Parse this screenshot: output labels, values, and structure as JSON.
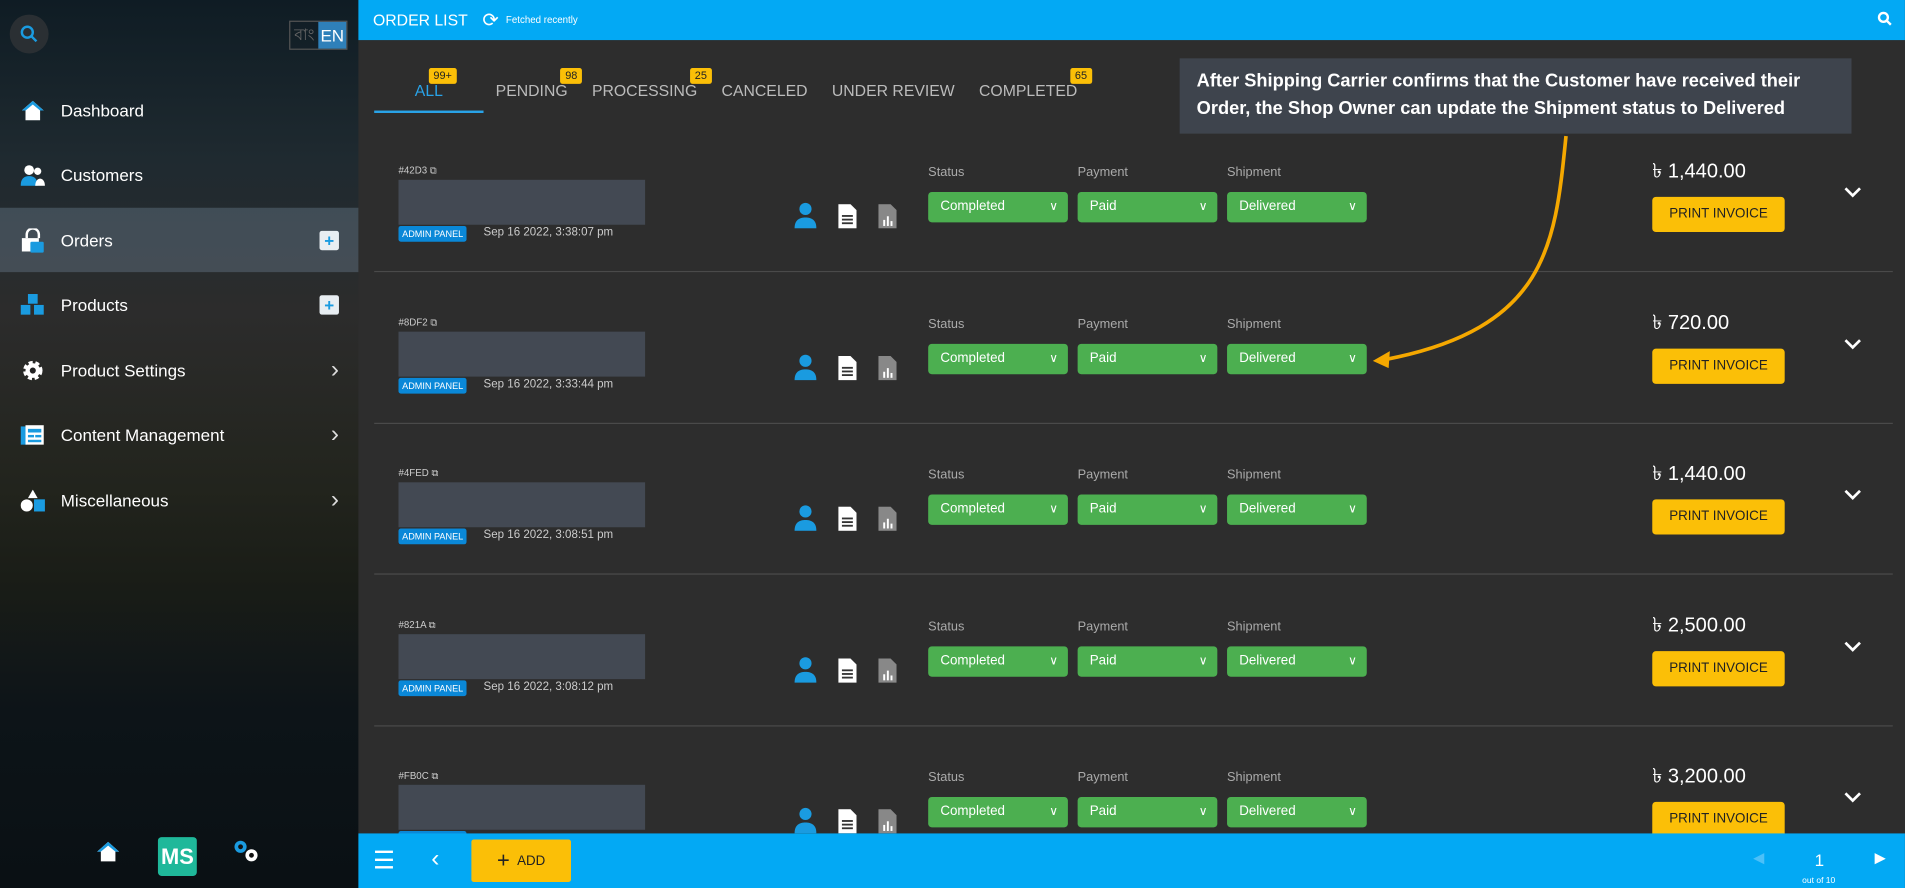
{
  "sidebar": {
    "lang": {
      "bn": "বাং",
      "en": "EN"
    },
    "items": [
      {
        "label": "Dashboard",
        "icon": "home-icon"
      },
      {
        "label": "Customers",
        "icon": "customers-icon"
      },
      {
        "label": "Orders",
        "icon": "orders-bag-icon",
        "right": "plus"
      },
      {
        "label": "Products",
        "icon": "boxes-icon",
        "right": "plus"
      },
      {
        "label": "Product Settings",
        "icon": "gear-icon",
        "right": "chevron"
      },
      {
        "label": "Content Management",
        "icon": "newspaper-icon",
        "right": "chevron"
      },
      {
        "label": "Miscellaneous",
        "icon": "shapes-icon",
        "right": "chevron"
      }
    ],
    "plus": "+",
    "chevron": "›",
    "logo": "MS"
  },
  "header": {
    "title": "ORDER LIST",
    "status": "Fetched recently"
  },
  "tabs": [
    {
      "label": "ALL",
      "badge": "99+"
    },
    {
      "label": "PENDING",
      "badge": "98"
    },
    {
      "label": "PROCESSING",
      "badge": "25"
    },
    {
      "label": "CANCELED"
    },
    {
      "label": "UNDER REVIEW"
    },
    {
      "label": "COMPLETED",
      "badge": "65"
    }
  ],
  "annotation": "After Shipping Carrier confirms that the Customer have received their Order, the Shop Owner can update the Shipment status to Delivered",
  "labels": {
    "status": "Status",
    "payment": "Payment",
    "shipment": "Shipment",
    "print": "PRINT INVOICE",
    "source": "ADMIN PANEL"
  },
  "orders": [
    {
      "id": "#42D3",
      "date": "Sep 16 2022, 3:38:07 pm",
      "status": "Completed",
      "payment": "Paid",
      "shipment": "Delivered",
      "amount": "৳ 1,440.00"
    },
    {
      "id": "#8DF2",
      "date": "Sep 16 2022, 3:33:44 pm",
      "status": "Completed",
      "payment": "Paid",
      "shipment": "Delivered",
      "amount": "৳ 720.00"
    },
    {
      "id": "#4FED",
      "date": "Sep 16 2022, 3:08:51 pm",
      "status": "Completed",
      "payment": "Paid",
      "shipment": "Delivered",
      "amount": "৳ 1,440.00"
    },
    {
      "id": "#821A",
      "date": "Sep 16 2022, 3:08:12 pm",
      "status": "Completed",
      "payment": "Paid",
      "shipment": "Delivered",
      "amount": "৳ 2,500.00"
    },
    {
      "id": "#FB0C",
      "date": "",
      "status": "Completed",
      "payment": "Paid",
      "shipment": "Delivered",
      "amount": "৳ 3,200.00"
    }
  ],
  "footer": {
    "add": "ADD",
    "page": "1",
    "page_of": "out of 10"
  },
  "colors": {
    "accent": "#03a9f4",
    "green": "#4caf50",
    "yellow": "#fbbf07",
    "arrow": "#f5a800"
  }
}
